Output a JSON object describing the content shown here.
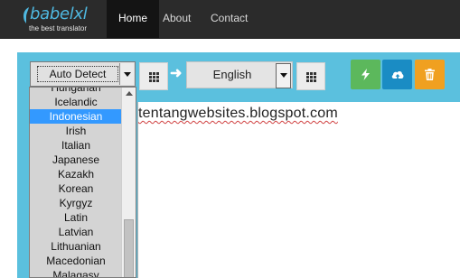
{
  "brand": {
    "name": "babelxl",
    "tagline": "the best translator"
  },
  "nav": [
    {
      "label": "Home",
      "active": true
    },
    {
      "label": "About",
      "active": false
    },
    {
      "label": "Contact",
      "active": false
    }
  ],
  "source": {
    "selected": "Auto Detect"
  },
  "target": {
    "selected": "English"
  },
  "editor": {
    "text": "tentangwebsites.blogspot.com"
  },
  "actions": [
    {
      "name": "translate",
      "icon": "lightning-icon",
      "color": "#5cb85c"
    },
    {
      "name": "upload",
      "icon": "cloud-upload-icon",
      "color": "#1a8cc4"
    },
    {
      "name": "delete",
      "icon": "trash-icon",
      "color": "#f0a020"
    }
  ],
  "language_list": {
    "items": [
      "Hungarian",
      "Icelandic",
      "Indonesian",
      "Irish",
      "Italian",
      "Japanese",
      "Kazakh",
      "Korean",
      "Kyrgyz",
      "Latin",
      "Latvian",
      "Lithuanian",
      "Macedonian",
      "Malagasy"
    ],
    "selected": "Indonesian"
  },
  "colors": {
    "panel": "#5bc0de",
    "navbar": "#2b2b2b",
    "highlight": "#3399ff"
  }
}
